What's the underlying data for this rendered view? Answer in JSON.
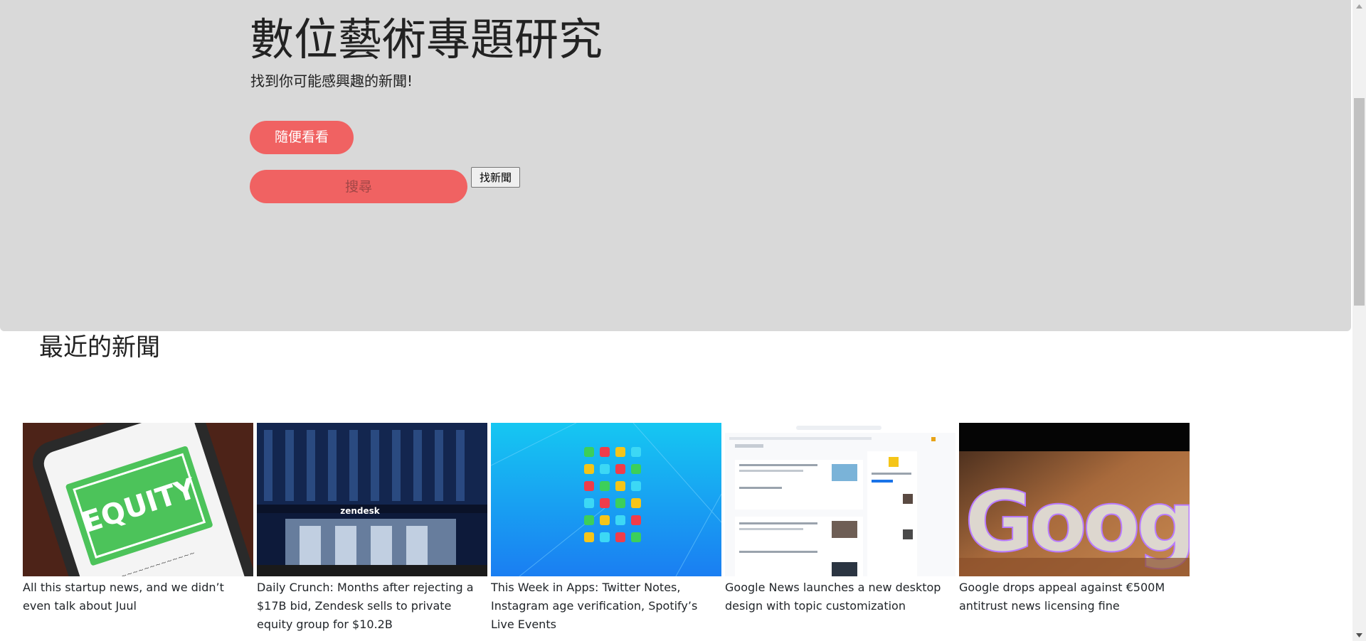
{
  "hero": {
    "title": "數位藝術專題研究",
    "subtitle": "找到你可能感興趣的新聞!",
    "browse_label": "隨便看看",
    "search_placeholder": "搜尋",
    "search_value": "",
    "find_label": "找新聞"
  },
  "recent": {
    "title": "最近的新聞",
    "articles": [
      {
        "caption": "All this startup news, and we didn’t even talk about Juul",
        "image": "equity-podcast-phone"
      },
      {
        "caption": "Daily Crunch: Months after rejecting a $17B bid, Zendesk sells to private equity group for $10.2B",
        "image": "zendesk-building"
      },
      {
        "caption": "This Week in Apps: Twitter Notes, Instagram age verification, Spotify’s Live Events",
        "image": "app-icons-grid"
      },
      {
        "caption": "Google News launches a new desktop design with topic customization",
        "image": "google-news-screenshot"
      },
      {
        "caption": "Google drops appeal against €500M antitrust news licensing fine",
        "image": "google-sign"
      }
    ]
  },
  "colors": {
    "hero_bg": "#d9d9d9",
    "accent": "#f06262",
    "button_text": "#ffffff"
  },
  "icons": {
    "scroll_up": "chevron-up-icon",
    "scroll_down": "chevron-down-icon"
  }
}
